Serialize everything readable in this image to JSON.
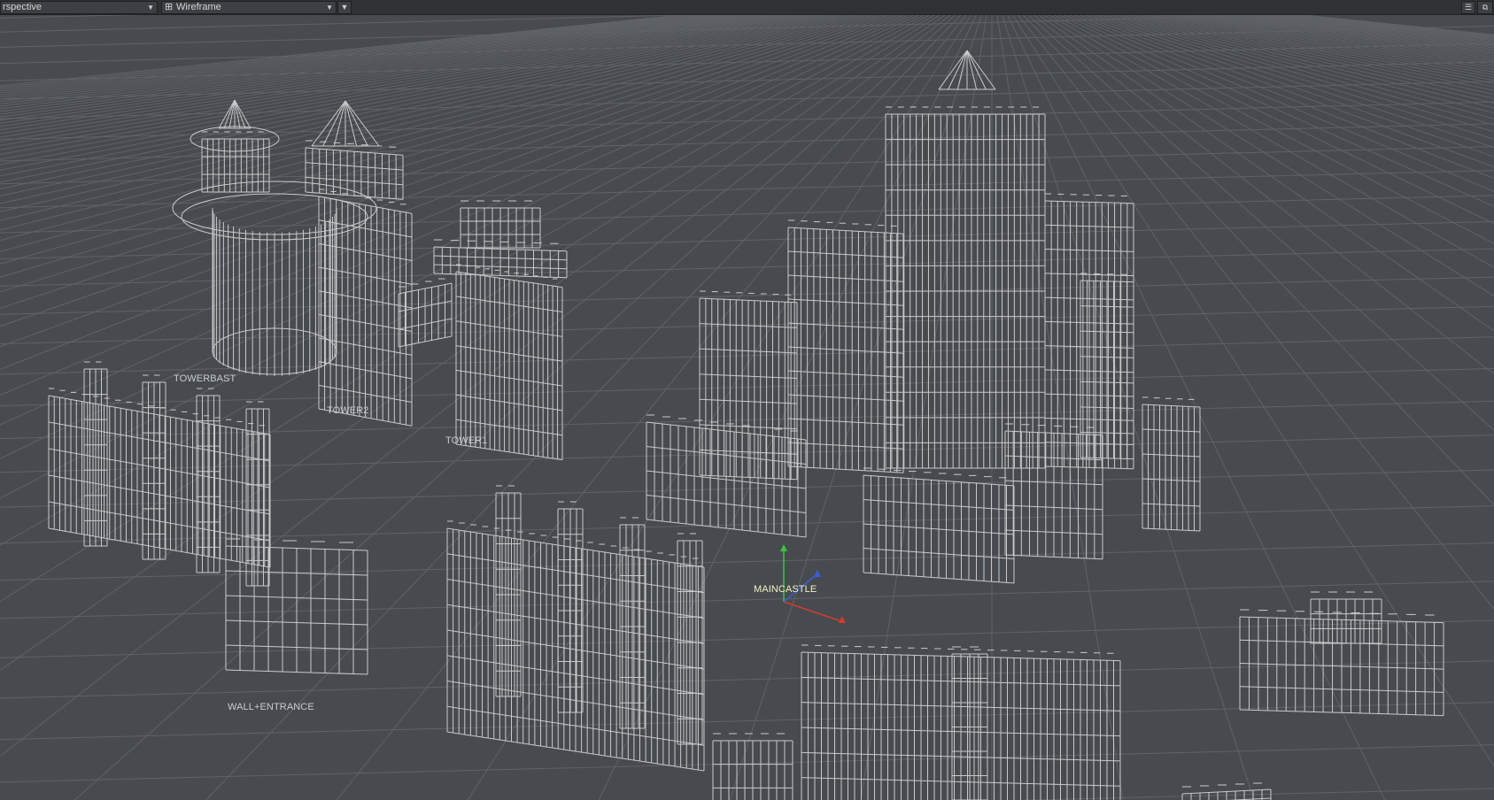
{
  "toolbar": {
    "view_mode": "rspective",
    "shading_mode": "Wireframe",
    "icons": [
      "wireframe-mode-icon",
      "dropdown-arrow-icon",
      "viewport-list-icon",
      "maximize-viewport-icon"
    ]
  },
  "viewport": {
    "background_color": "#474b4f",
    "grid_color": "#5f6367",
    "wire_color": "#c9c9c9",
    "objects": [
      {
        "label": "TOWERBAST"
      },
      {
        "label": "TOWER2"
      },
      {
        "label": "TOWER1"
      },
      {
        "label": "MAINCASTLE"
      },
      {
        "label": "WALL+ENTRANCE"
      }
    ],
    "gizmo": {
      "x_color": "#d43a2f",
      "y_color": "#3cc43c",
      "z_color": "#3a5ed6"
    }
  }
}
